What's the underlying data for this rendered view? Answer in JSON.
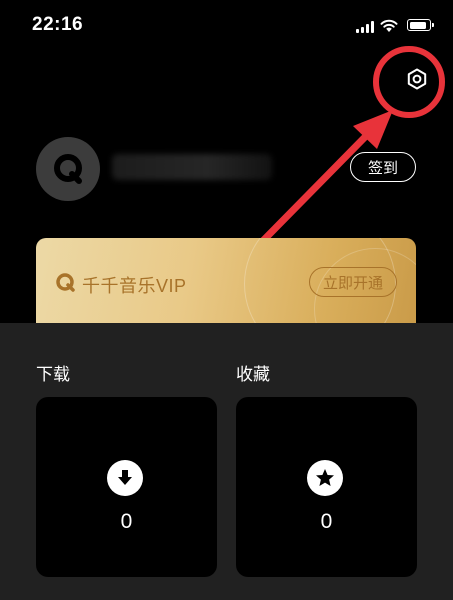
{
  "status_bar": {
    "time": "22:16",
    "battery_level": 0.9
  },
  "profile": {
    "checkin_label": "签到"
  },
  "vip_card": {
    "title": "千千音乐VIP",
    "button_label": "立即开通",
    "accent_color": "#a8732a"
  },
  "sections": [
    {
      "title": "下载",
      "count": "0",
      "icon": "download-icon"
    },
    {
      "title": "收藏",
      "count": "0",
      "icon": "star-icon"
    }
  ],
  "annotation": {
    "color": "#e8333a"
  }
}
